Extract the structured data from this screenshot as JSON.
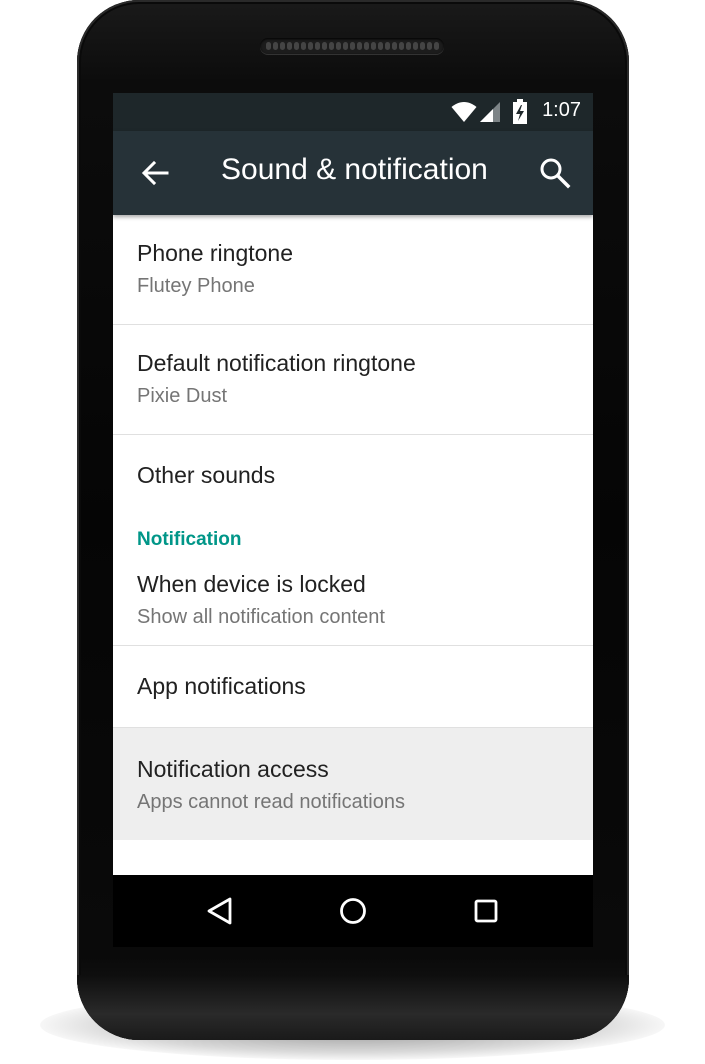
{
  "status_bar": {
    "time": "1:07",
    "icons": [
      "wifi-icon",
      "cell-signal-icon",
      "battery-charging-icon"
    ]
  },
  "app_bar": {
    "title": "Sound & notification",
    "back_icon": "arrow-back-icon",
    "search_icon": "search-icon"
  },
  "settings": {
    "phone_ringtone": {
      "title": "Phone ringtone",
      "summary": "Flutey Phone"
    },
    "default_notification_ringtone": {
      "title": "Default notification ringtone",
      "summary": "Pixie Dust"
    },
    "other_sounds": {
      "title": "Other sounds"
    },
    "notification_section": "Notification",
    "when_locked": {
      "title": "When device is locked",
      "summary": "Show all notification content"
    },
    "app_notifications": {
      "title": "App notifications"
    },
    "notification_access": {
      "title": "Notification access",
      "summary": "Apps cannot read notifications"
    }
  },
  "nav_bar": {
    "icons": [
      "nav-back-icon",
      "home-icon",
      "recents-icon"
    ]
  },
  "colors": {
    "status_bar": "#1e272a",
    "app_bar": "#263238",
    "accent": "#009688",
    "selected_row": "#eeeeee"
  }
}
